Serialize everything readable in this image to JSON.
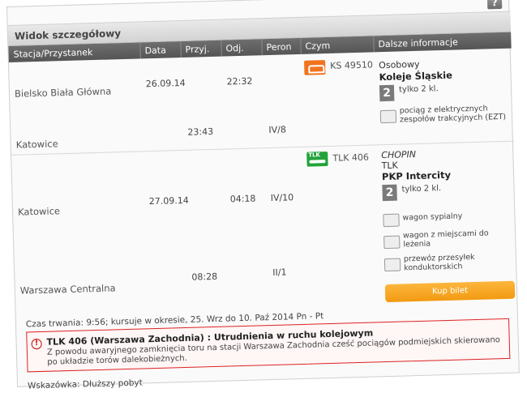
{
  "help_label": "?",
  "title": "Widok szczegółowy",
  "columns": [
    "Stacja/Przystanek",
    "Data",
    "Przyj.",
    "Odj.",
    "Peron",
    "Czym",
    "Dalsze informacje"
  ],
  "trip1": {
    "from_station": "Bielsko Biała Główna",
    "from_date": "26.09.14",
    "from_dep": "22:32",
    "to_station": "Katowice",
    "to_arr": "23:43",
    "to_platform": "IV/8",
    "train_no": "KS 49510",
    "train_icon": "ks-train-icon",
    "type": "Osobowy",
    "carrier": "Koleje Śląskie",
    "class_num": "2",
    "class_text": "tylko 2 kl.",
    "feature": "pociąg z elektrycznych zespołów trakcyjnych (EZT)"
  },
  "trip2": {
    "from_station": "Katowice",
    "from_date": "27.09.14",
    "from_dep": "04:18",
    "from_platform": "IV/10",
    "to_station": "Warszawa Centralna",
    "to_arr": "08:28",
    "to_platform": "II/1",
    "train_no": "TLK 406",
    "train_icon": "tlk-train-icon",
    "name": "CHOPIN",
    "category": "TLK",
    "carrier": "PKP Intercity",
    "class_num": "2",
    "class_text": "tylko 2 kl.",
    "features": [
      "wagon sypialny",
      "wagon z miejscami do leżenia",
      "przewóz przesyłek konduktorskich"
    ],
    "buy_label": "Kup bilet"
  },
  "duration": "Czas trwania: 9:56; kursuje w okresie, 25. Wrz do 10. Paź 2014 Pn - Pt",
  "alert": {
    "icon": "!",
    "title": "TLK 406  (Warszawa Zachodnia) : Utrudnienia w ruchu kolejowym",
    "body": "Z powodu awaryjnego zamknięcia toru na stacji Warszawa Zachodnia cześć pociągów podmiejskich skierowano po układzie torów dalekobieżnych."
  },
  "hint": "Wskazówka: Dłuższy pobyt"
}
